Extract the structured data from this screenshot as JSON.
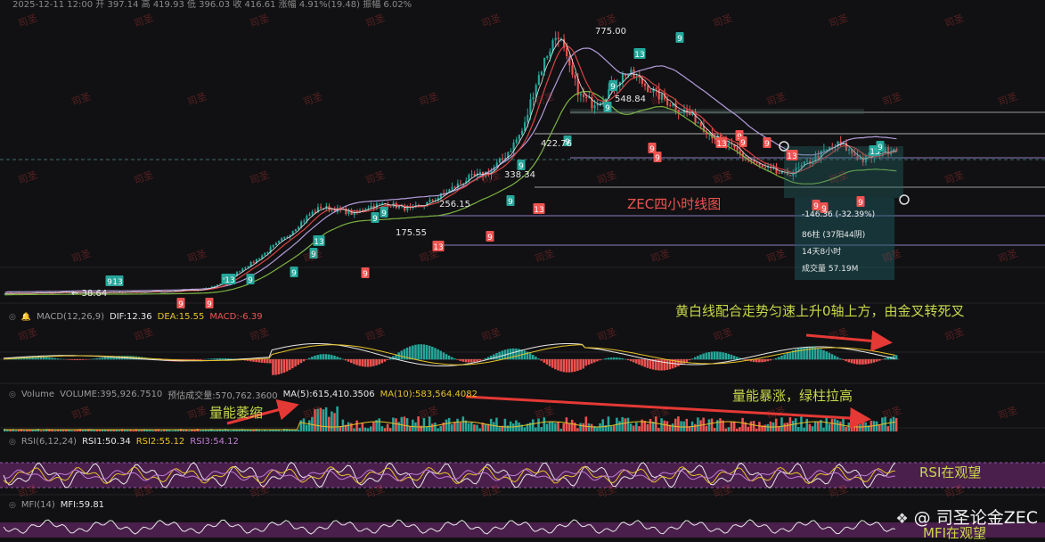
{
  "header": {
    "text": "2025-12-11 12:00  开 397.14  高 419.93  低 396.03  收 416.61  涨幅 4.91%(19.48)  振幅 6.02%"
  },
  "price_labels": [
    "775.00",
    "548.84",
    "422.76",
    "338.34",
    "256.15",
    "175.55",
    "38.64"
  ],
  "chart_title": "ZEC四小时线图",
  "measure": {
    "change": "-146.36 (-32.39%)",
    "bars": "86柱 (37阳44阴)",
    "duration": "14天8小时",
    "volume": "成交量 57.19M"
  },
  "seq_labels": [
    "9",
    "13"
  ],
  "macd": {
    "name": "MACD(12,26,9)",
    "dif": "DIF:12.36",
    "dea": "DEA:15.55",
    "macd": "MACD:-6.39"
  },
  "volume": {
    "name": "Volume",
    "vol": "VOLUME:395,926.7510",
    "est": "预估成交量:570,762.3600",
    "ma5": "MA(5):615,410.3506",
    "ma10": "MA(10):583,564.4082"
  },
  "rsi": {
    "name": "RSI(6,12,24)",
    "r1": "RSI1:50.34",
    "r2": "RSI2:55.12",
    "r3": "RSI3:54.12"
  },
  "mfi": {
    "name": "MFI(14)",
    "v": "MFI:59.81"
  },
  "annotations": {
    "macd_note": "黄白线配合走势匀速上升0轴上方，由金叉转死叉",
    "vol_shrink": "量能萎缩",
    "vol_surge": "量能暴涨，绿柱拉高",
    "rsi_note": "RSI在观望",
    "mfi_note": "MFI在观望"
  },
  "watermark": "司圣",
  "footer": "@ 司圣论金ZEC",
  "colors": {
    "up": "#26a69a",
    "down": "#ef5350",
    "dif": "#e8e8e8",
    "dea": "#e6c229",
    "macd": "#ef5350",
    "ma_white": "#e8e8e8",
    "ma_purple": "#b39ddb",
    "ma_red": "#d84343",
    "ma_green": "#7cb342",
    "annotation": "#c8d84a",
    "rsi_band": "#4a1f4c"
  },
  "chart_data": {
    "type": "candlestick",
    "symbol": "ZEC",
    "timeframe": "4H",
    "key_prices": [
      38.64,
      175.55,
      256.15,
      338.34,
      422.76,
      548.84,
      775.0
    ],
    "peak": 775.0,
    "last_close": 416.61,
    "last_change_pct": 4.91,
    "indicators": {
      "DIF": 12.36,
      "DEA": 15.55,
      "MACD": -6.39,
      "VOLUME": 395926.751,
      "MA5": 615410.3506,
      "MA10": 583564.4082,
      "RSI1": 50.34,
      "RSI2": 55.12,
      "RSI3": 54.12,
      "MFI": 59.81
    },
    "price_path": [
      38,
      39,
      38,
      40,
      39,
      41,
      40,
      39,
      40,
      41,
      40,
      42,
      41,
      43,
      42,
      44,
      46,
      45,
      50,
      60,
      75,
      95,
      110,
      130,
      150,
      170,
      200,
      230,
      250,
      245,
      240,
      230,
      250,
      256,
      260,
      250,
      245,
      255,
      270,
      290,
      310,
      330,
      338,
      350,
      380,
      420,
      470,
      600,
      700,
      775,
      650,
      560,
      540,
      560,
      600,
      640,
      620,
      590,
      560,
      540,
      520,
      500,
      470,
      440,
      420,
      400,
      380,
      360,
      350,
      340,
      350,
      370,
      390,
      410,
      425,
      400,
      380,
      395,
      405,
      416
    ]
  }
}
